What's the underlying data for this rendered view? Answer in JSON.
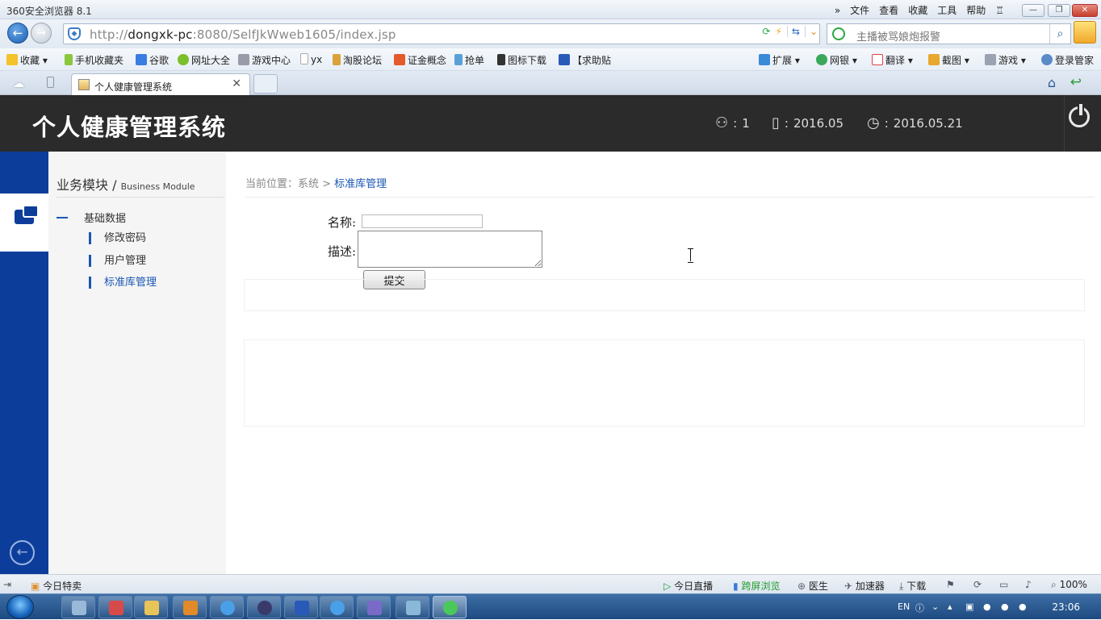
{
  "browser": {
    "title": "360安全浏览器 8.1",
    "menus": [
      "文件",
      "查看",
      "收藏",
      "工具",
      "帮助"
    ],
    "url_prefix": "http://",
    "url_host": "dongxk-pc",
    "url_rest": ":8080/SelfJkWweb1605/index.jsp",
    "search_placeholder": "主播被骂娘炮报警",
    "favorites": [
      "收藏",
      "手机收藏夹",
      "谷歌",
      "网址大全",
      "游戏中心",
      "yx",
      "淘股论坛",
      "证金概念",
      "抢单",
      "图标下载",
      "【求助贴"
    ],
    "fav_right": [
      "扩展",
      "网银",
      "翻译",
      "截图",
      "游戏",
      "登录管家"
    ],
    "tab_label": "个人健康管理系统"
  },
  "app": {
    "title": "个人健康管理系统",
    "user_count": "1",
    "month": "2016.05",
    "date": "2016.05.21"
  },
  "sidebar": {
    "module_title": "业务模块 / ",
    "module_subtitle": "Business Module",
    "group_label": "基础数据",
    "items": [
      {
        "label": "修改密码"
      },
      {
        "label": "用户管理"
      },
      {
        "label": "标准库管理"
      }
    ]
  },
  "breadcrumb": {
    "prefix": "当前位置：系统 > ",
    "current": "标准库管理"
  },
  "form": {
    "name_label": "名称:",
    "desc_label": "描述:",
    "name_value": "",
    "desc_value": "",
    "submit_label": "提交"
  },
  "statusbar": {
    "left": "今日特卖",
    "live": "今日直播",
    "cross_screen": "跨屏浏览",
    "doctor": "医生",
    "accelerator": "加速器",
    "download": "下载",
    "zoom": "100%"
  },
  "taskbar": {
    "lang": "EN",
    "time": "23:06"
  },
  "colors": {
    "header_bg": "#2b2b2b",
    "left_strip": "#0d3d9a",
    "accent": "#1a56b3"
  }
}
